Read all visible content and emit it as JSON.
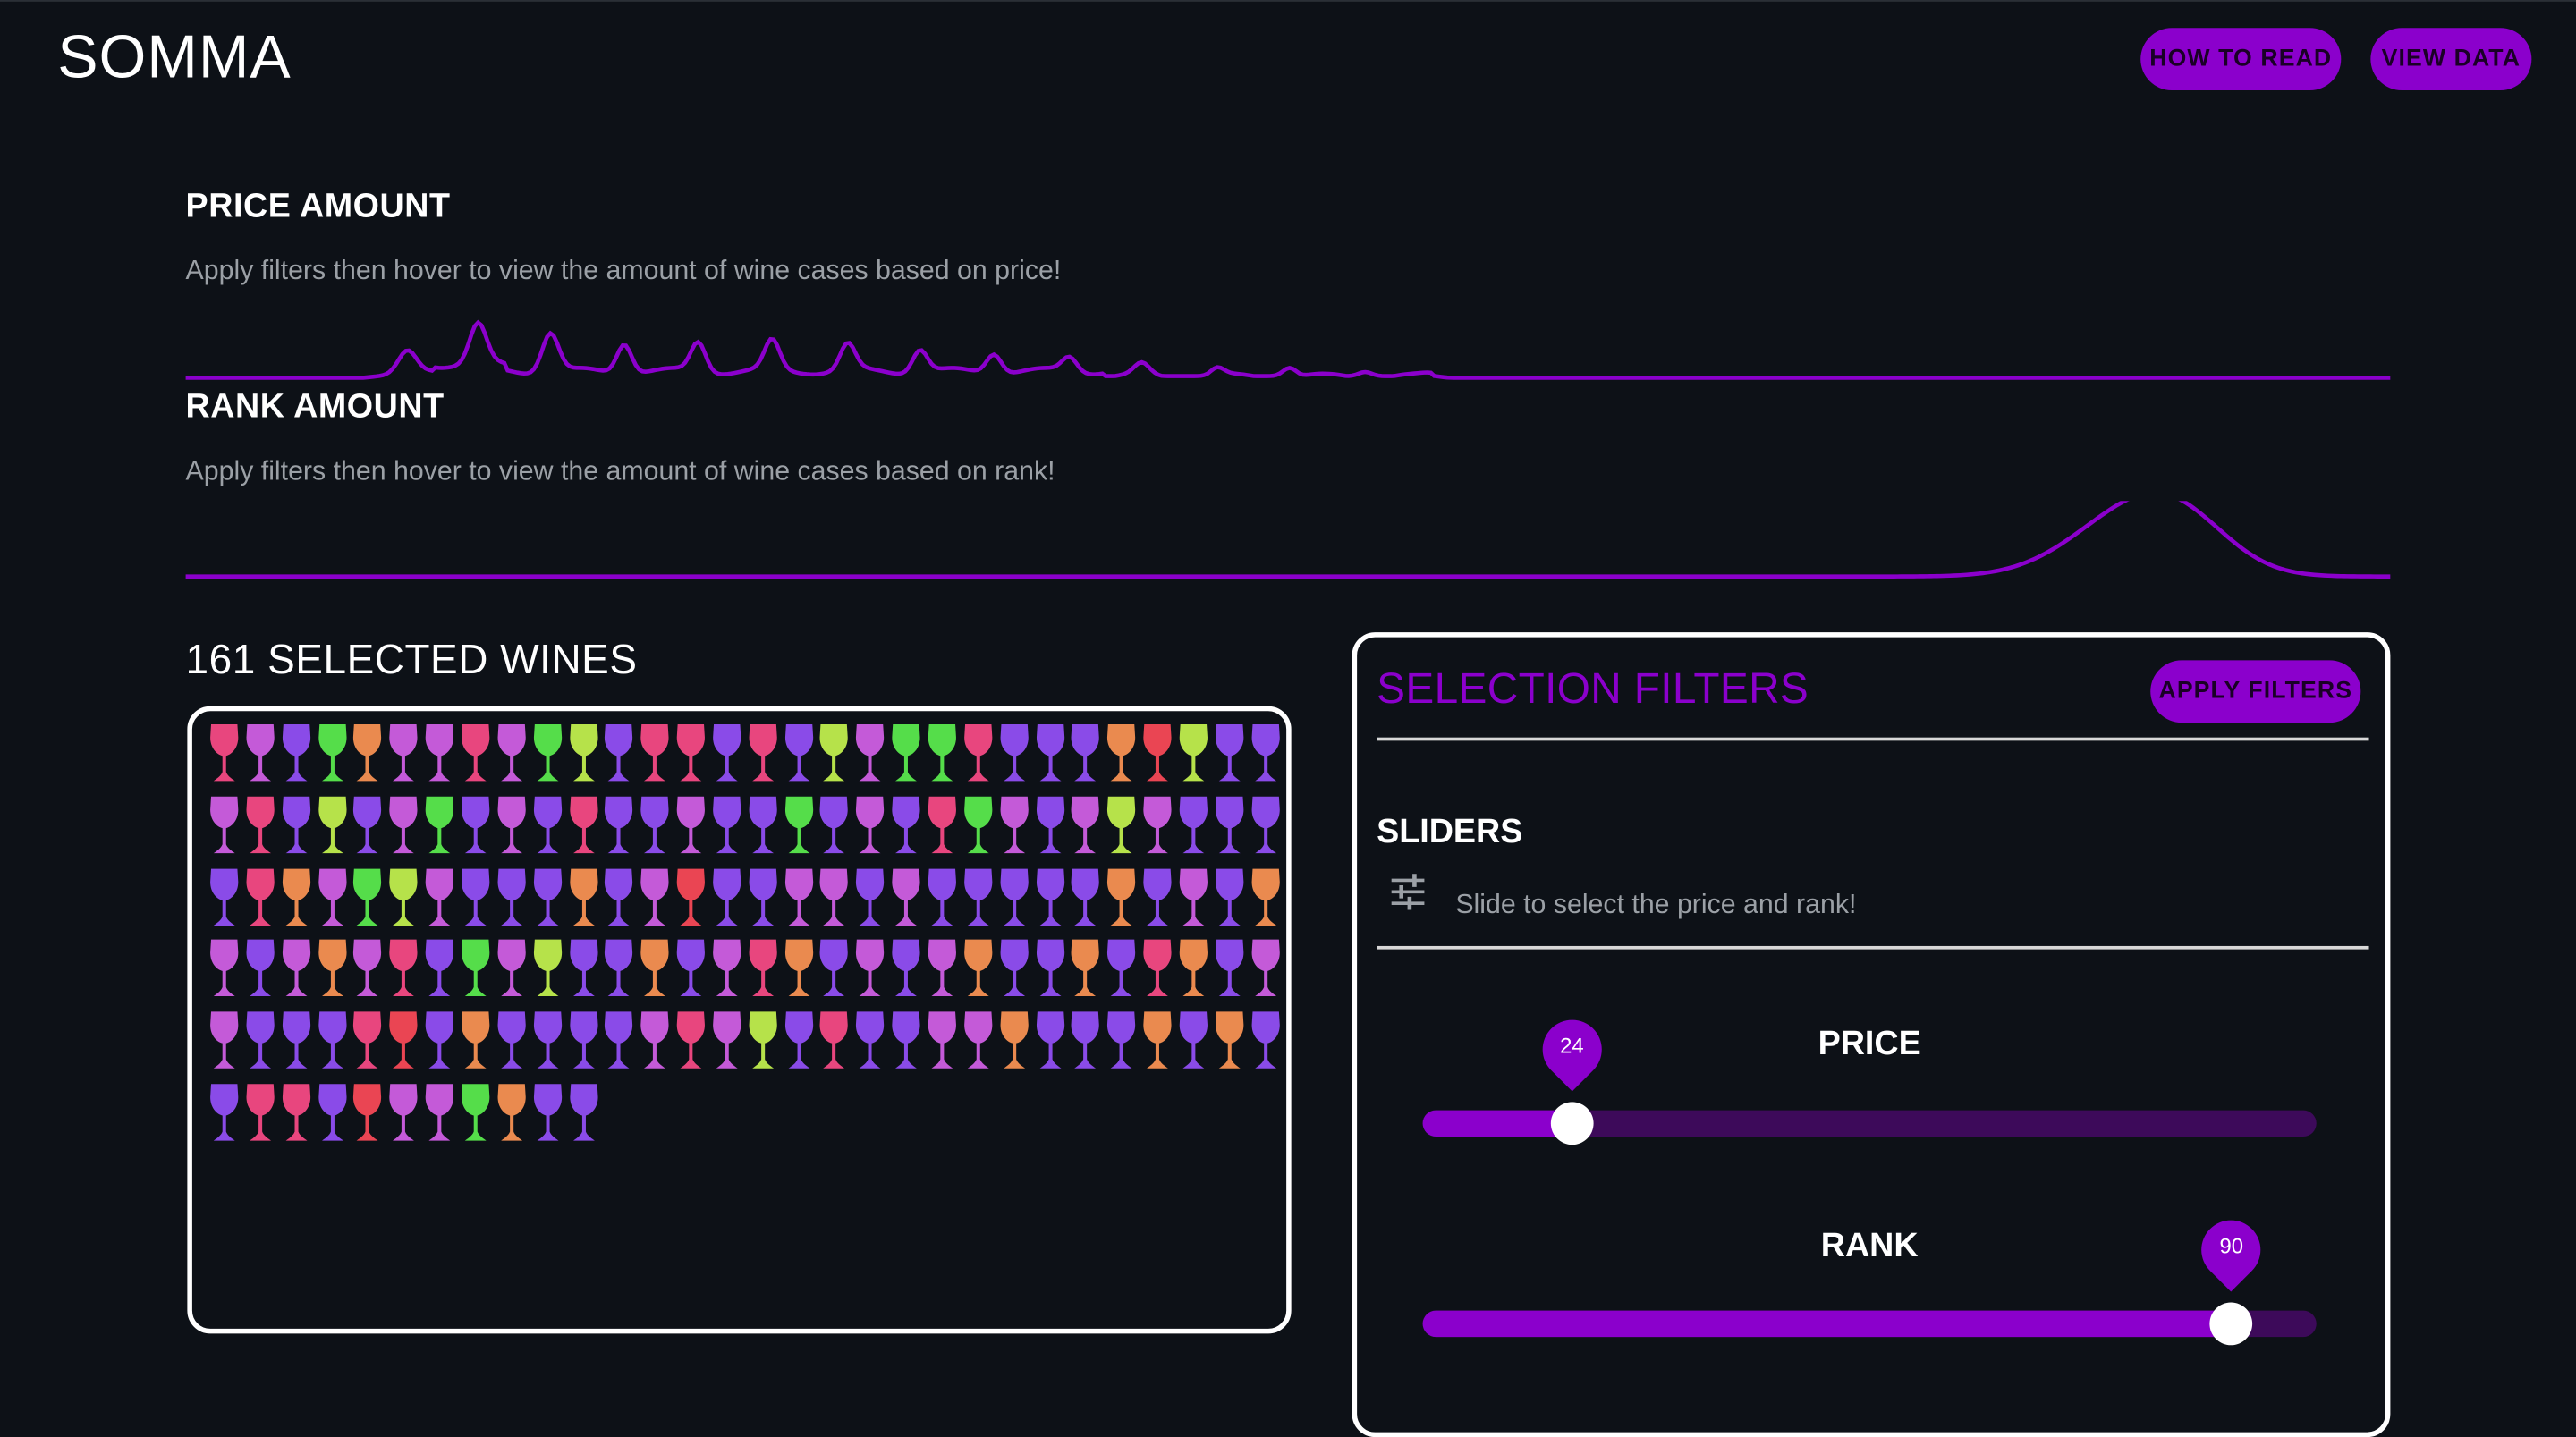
{
  "app": {
    "title": "SOMMA"
  },
  "header": {
    "how_to_read": "HOW TO READ",
    "view_data": "VIEW DATA"
  },
  "price_amount": {
    "title": "PRICE AMOUNT",
    "description": "Apply filters then hover to view the amount of wine cases based on price!"
  },
  "rank_amount": {
    "title": "RANK AMOUNT",
    "description": "Apply filters then hover to view the amount of wine cases based on rank!"
  },
  "wines": {
    "title": "161 SELECTED WINES",
    "count": 161,
    "colors": {
      "pink": "#e8467e",
      "purple": "#8a4be8",
      "violet": "#c45ad8",
      "green": "#55dd4a",
      "lime": "#b6e24a",
      "orange": "#ea8a4f",
      "red": "#ea4553"
    },
    "rows": [
      [
        "pink",
        "violet",
        "purple",
        "green",
        "orange",
        "violet",
        "violet",
        "pink",
        "violet",
        "green",
        "lime",
        "purple",
        "pink",
        "pink",
        "purple",
        "pink",
        "purple",
        "lime",
        "violet",
        "green",
        "green",
        "pink",
        "purple",
        "purple",
        "purple",
        "orange",
        "red",
        "lime",
        "purple",
        "purple"
      ],
      [
        "violet",
        "pink",
        "purple",
        "lime",
        "purple",
        "violet",
        "green",
        "purple",
        "violet",
        "purple",
        "pink",
        "purple",
        "purple",
        "violet",
        "purple",
        "purple",
        "green",
        "purple",
        "violet",
        "purple",
        "pink",
        "green",
        "violet",
        "purple",
        "violet",
        "lime",
        "violet",
        "purple",
        "purple",
        "purple"
      ],
      [
        "purple",
        "pink",
        "orange",
        "violet",
        "green",
        "lime",
        "violet",
        "purple",
        "purple",
        "purple",
        "orange",
        "purple",
        "violet",
        "red",
        "purple",
        "purple",
        "violet",
        "violet",
        "purple",
        "violet",
        "purple",
        "purple",
        "purple",
        "purple",
        "purple",
        "orange",
        "purple",
        "violet",
        "purple",
        "orange"
      ],
      [
        "violet",
        "purple",
        "violet",
        "orange",
        "violet",
        "pink",
        "purple",
        "green",
        "violet",
        "lime",
        "purple",
        "purple",
        "orange",
        "purple",
        "violet",
        "pink",
        "orange",
        "purple",
        "violet",
        "purple",
        "violet",
        "orange",
        "purple",
        "purple",
        "orange",
        "purple",
        "pink",
        "orange",
        "purple",
        "violet"
      ],
      [
        "violet",
        "purple",
        "purple",
        "purple",
        "pink",
        "red",
        "purple",
        "orange",
        "purple",
        "purple",
        "purple",
        "purple",
        "violet",
        "pink",
        "violet",
        "lime",
        "purple",
        "pink",
        "purple",
        "purple",
        "violet",
        "violet",
        "orange",
        "purple",
        "purple",
        "purple",
        "orange",
        "purple",
        "orange",
        "purple"
      ],
      [
        "purple",
        "pink",
        "pink",
        "purple",
        "red",
        "violet",
        "violet",
        "green",
        "orange",
        "purple",
        "purple"
      ]
    ]
  },
  "filters": {
    "title": "SELECTION FILTERS",
    "apply_label": "APPLY FILTERS",
    "sliders_title": "SLIDERS",
    "sliders_icon": "tune-icon",
    "sliders_description": "Slide to select the price and rank!",
    "price": {
      "label": "PRICE",
      "value": 24,
      "fraction": 0.167
    },
    "rank": {
      "label": "RANK",
      "value": 90,
      "fraction": 0.905
    }
  },
  "accent_color": "#8b00cc",
  "background_color": "#0d1117"
}
